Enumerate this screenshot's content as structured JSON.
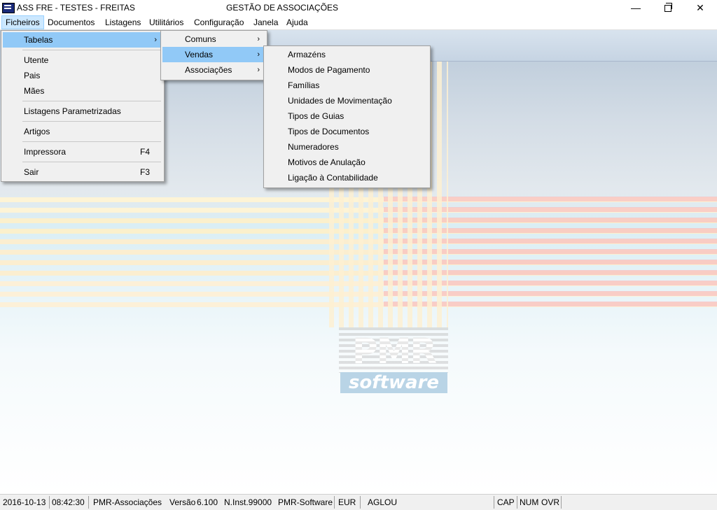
{
  "window": {
    "title": "ASS FRE - TESTES - FREITAS",
    "center_title": "GESTÃO DE ASSOCIAÇÕES",
    "minimize_glyph": "—",
    "close_glyph": "✕"
  },
  "menubar": {
    "items": [
      "Ficheiros",
      "Documentos",
      "Listagens",
      "Utilitários",
      "Configuração",
      "Janela",
      "Ajuda"
    ]
  },
  "menus": {
    "ficheiros": {
      "items": [
        {
          "label": "Tabelas",
          "submenu": true
        },
        {
          "label": "Utente"
        },
        {
          "label": "Pais"
        },
        {
          "label": "Mães"
        },
        {
          "label": "Listagens Parametrizadas"
        },
        {
          "label": "Artigos"
        },
        {
          "label": "Impressora",
          "shortcut": "F4"
        },
        {
          "label": "Sair",
          "shortcut": "F3"
        }
      ]
    },
    "tabelas": {
      "items": [
        {
          "label": "Comuns",
          "submenu": true
        },
        {
          "label": "Vendas",
          "submenu": true
        },
        {
          "label": "Associações",
          "submenu": true
        }
      ]
    },
    "vendas": {
      "items": [
        {
          "label": "Armazéns"
        },
        {
          "label": "Modos de Pagamento"
        },
        {
          "label": "Famílias"
        },
        {
          "label": "Unidades de Movimentação"
        },
        {
          "label": "Tipos de Guias"
        },
        {
          "label": "Tipos de Documentos"
        },
        {
          "label": "Numeradores"
        },
        {
          "label": "Motivos de Anulação"
        },
        {
          "label": "Ligação à Contabilidade"
        }
      ]
    },
    "arrow_glyph": "›"
  },
  "logo": {
    "text": "PMR",
    "subtitle": "software"
  },
  "statusbar": {
    "date": "2016-10-13",
    "time": "08:42:30",
    "app": "PMR-Associações",
    "version_label": "Versão",
    "version": "6.100",
    "install": "N.Inst.99000",
    "company": "PMR-Software",
    "currency": "EUR",
    "user": "AGLOU",
    "cap": "CAP",
    "num": "NUM",
    "ovr": "OVR"
  },
  "colors": {
    "menu_highlight": "#91c9f7",
    "menubar_active": "#cce8ff"
  }
}
